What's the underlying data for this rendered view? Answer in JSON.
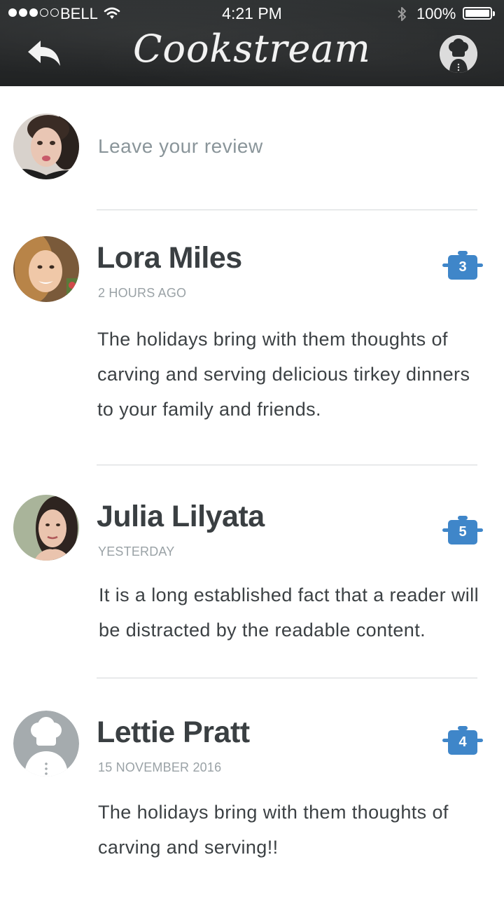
{
  "status_bar": {
    "signal_dots": [
      true,
      true,
      true,
      false,
      false
    ],
    "carrier": "BELL",
    "time": "4:21 PM",
    "battery": "100%"
  },
  "header": {
    "title": "Cookstream",
    "back_icon": "reply-arrow-icon",
    "profile_icon": "chef-hat-icon"
  },
  "compose": {
    "placeholder": "Leave your review"
  },
  "reviews": [
    {
      "name": "Lora Miles",
      "time": "2 HOURS AGO",
      "text": "The holidays bring with them thoughts of carving and serving delicious tirkey dinners to your family and friends.",
      "rating": "3"
    },
    {
      "name": "Julia Lilyata",
      "time": "YESTERDAY",
      "text": "It is a long established fact that a reader will be distracted by the readable content.",
      "rating": "5"
    },
    {
      "name": "Lettie Pratt",
      "time": "15 NOVEMBER 2016",
      "text": "The holidays bring with them thoughts of carving and serving!!",
      "rating": "4"
    }
  ],
  "colors": {
    "header_bg": "#262829",
    "badge": "#3f86c9",
    "name_text": "#3a3f42",
    "meta_text": "#9aa2a6"
  }
}
